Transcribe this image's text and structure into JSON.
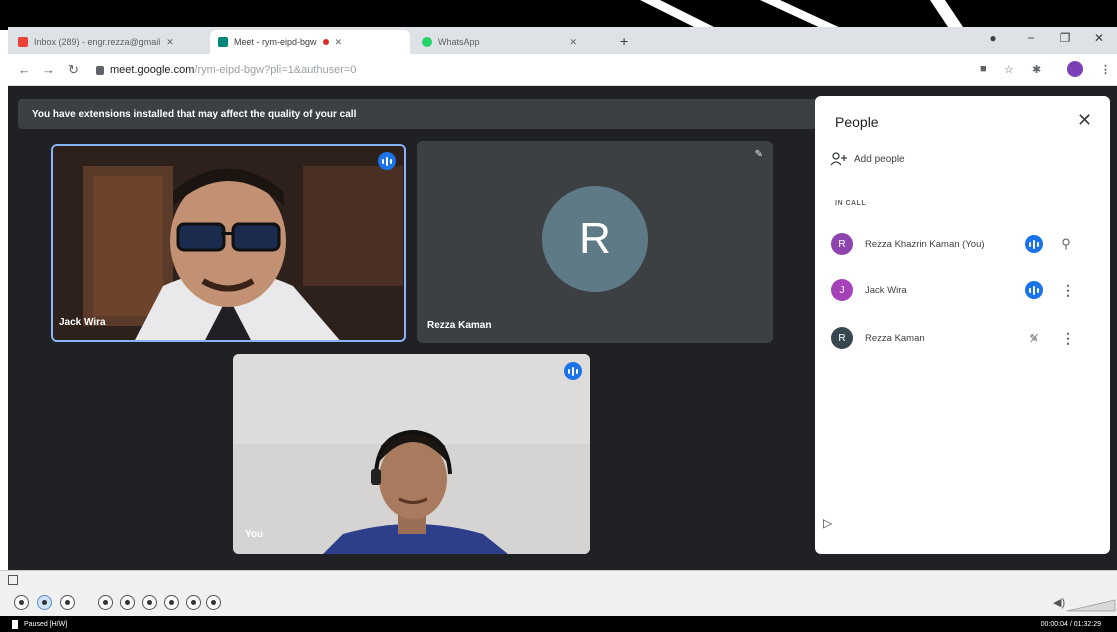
{
  "browser": {
    "tabs": [
      {
        "title": "Inbox (289) - engr.rezza@gmail"
      },
      {
        "title": "Meet - rym-eipd-bgw"
      },
      {
        "title": "WhatsApp"
      }
    ],
    "url_host": "meet.google.com",
    "url_path": "/rym-eipd-bgw?pli=1&authuser=0",
    "new_tab": "+",
    "minimize": "−",
    "restore": "❐",
    "close": "✕"
  },
  "meet": {
    "warning": "You have extensions installed that may affect the quality of your call",
    "tiles": [
      {
        "name": "Jack Wira"
      },
      {
        "name": "Rezza Kaman",
        "initial": "R"
      },
      {
        "name": "You"
      }
    ]
  },
  "people_panel": {
    "title": "People",
    "add_people": "Add people",
    "section": "IN CALL",
    "participants": [
      {
        "initial": "R",
        "name": "Rezza Khazrin Kaman (You)",
        "color": "#8e44ad"
      },
      {
        "initial": "J",
        "name": "Jack Wira",
        "color": "#a642b8"
      },
      {
        "initial": "R",
        "name": "Rezza Kaman",
        "color": "#37474f"
      }
    ]
  },
  "player": {
    "status_left": "Paused [H/W]",
    "status_right": "00:00:04 / 01:32:29"
  }
}
